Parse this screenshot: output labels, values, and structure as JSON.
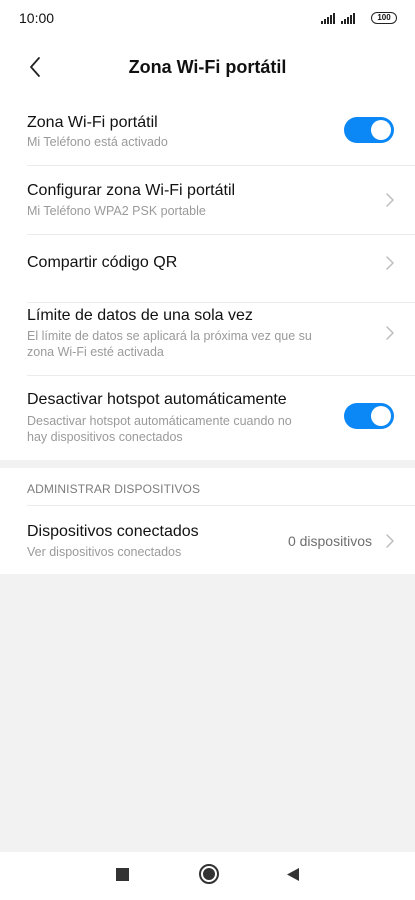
{
  "status_bar": {
    "time": "10:00",
    "battery": "100"
  },
  "header": {
    "title": "Zona Wi-Fi portátil",
    "back_icon": "chevron-left-icon"
  },
  "settings": [
    {
      "title": "Zona Wi-Fi portátil",
      "subtitle": "Mi Teléfono está activado",
      "control": "toggle",
      "on": true
    },
    {
      "title": "Configurar zona Wi-Fi portátil",
      "subtitle": "Mi Teléfono WPA2 PSK portable",
      "control": "chevron"
    },
    {
      "title": "Compartir código QR",
      "control": "chevron"
    },
    {
      "title": "Límite de datos de una sola vez",
      "subtitle_line1": "El límite de datos se aplicará la próxima vez que su",
      "subtitle_line2": "zona Wi-Fi esté activada",
      "control": "chevron"
    },
    {
      "title": "Desactivar hotspot automáticamente",
      "subtitle_line1": "Desactivar hotspot automáticamente cuando no",
      "subtitle_line2": "hay dispositivos conectados",
      "control": "toggle",
      "on": true
    }
  ],
  "devices_section": {
    "label": "ADMINISTRAR DISPOSITIVOS",
    "row": {
      "title": "Dispositivos conectados",
      "subtitle": "Ver dispositivos conectados",
      "value": "0 dispositivos",
      "control": "chevron"
    }
  },
  "nav_bar": {
    "recents_icon": "square-icon",
    "home_icon": "circle-home-icon",
    "back_icon": "triangle-back-icon"
  },
  "colors": {
    "accent": "#0b88f6",
    "background": "#f2f2f2",
    "surface": "#ffffff",
    "subtitle": "#9a9a9a"
  }
}
